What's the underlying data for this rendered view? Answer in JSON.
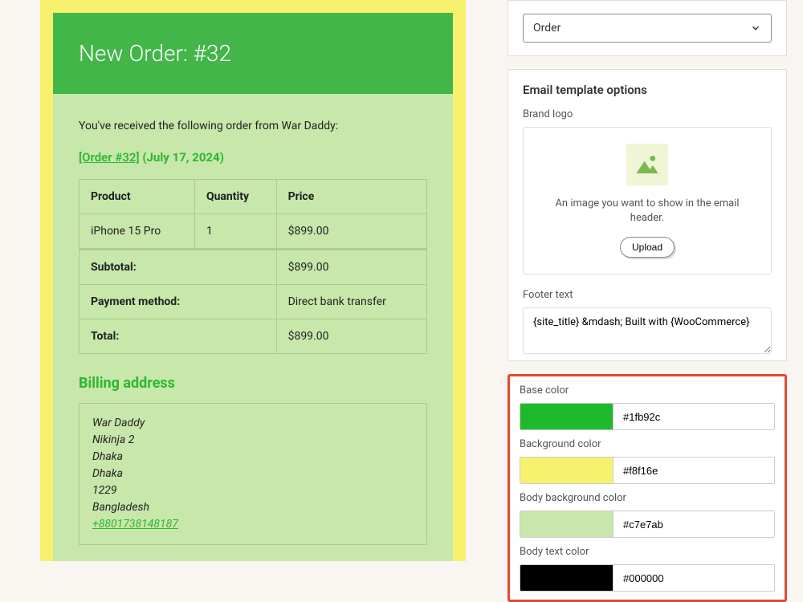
{
  "preview": {
    "title": "New Order: #32",
    "intro": "You've received the following order from War Daddy:",
    "order_link": "[Order #32]",
    "order_date": "(July 17, 2024)",
    "columns": {
      "product": "Product",
      "quantity": "Quantity",
      "price": "Price"
    },
    "line_item": {
      "product": "iPhone 15 Pro",
      "quantity": "1",
      "price": "$899.00"
    },
    "subtotal_label": "Subtotal:",
    "subtotal_value": "$899.00",
    "payment_label": "Payment method:",
    "payment_value": "Direct bank transfer",
    "total_label": "Total:",
    "total_value": "$899.00",
    "billing_heading": "Billing address",
    "billing": {
      "name": "War Daddy",
      "addr1": "Nikinja 2",
      "addr2": "Dhaka",
      "city": "Dhaka",
      "zip": "1229",
      "country": "Bangladesh",
      "phone": "+8801738148187"
    }
  },
  "sidebar": {
    "dropdown_value": "Order",
    "section_heading": "Email template options",
    "logo_label": "Brand logo",
    "logo_caption": "An image you want to show in the email header.",
    "upload_label": "Upload",
    "footer_label": "Footer text",
    "footer_value": "{site_title} &mdash; Built with {WooCommerce}",
    "colors": {
      "base": {
        "label": "Base color",
        "hex": "#1fb92c"
      },
      "bg": {
        "label": "Background color",
        "hex": "#f8f16e"
      },
      "bodybg": {
        "label": "Body background color",
        "hex": "#c7e7ab"
      },
      "text": {
        "label": "Body text color",
        "hex": "#000000"
      }
    }
  }
}
